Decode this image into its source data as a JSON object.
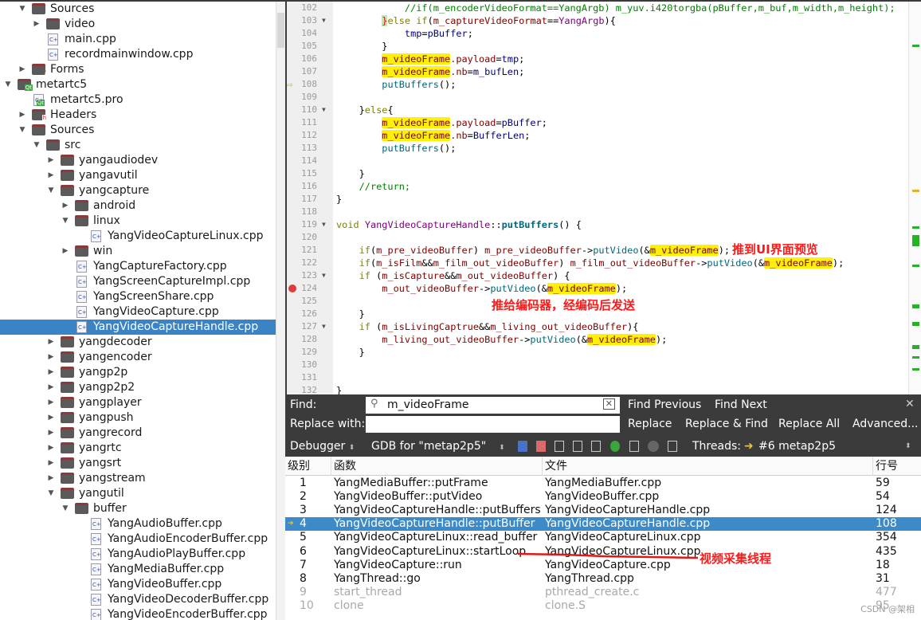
{
  "project_tree": {
    "items": [
      {
        "label": "Sources",
        "depth": 1,
        "kind": "cpp-folder",
        "arrow": "down"
      },
      {
        "label": "video",
        "depth": 2,
        "kind": "folder",
        "arrow": "right"
      },
      {
        "label": "main.cpp",
        "depth": 2,
        "kind": "file"
      },
      {
        "label": "recordmainwindow.cpp",
        "depth": 2,
        "kind": "file"
      },
      {
        "label": "Forms",
        "depth": 1,
        "kind": "forms-folder",
        "arrow": "right"
      },
      {
        "label": "metartc5",
        "depth": 0,
        "kind": "qt-project",
        "arrow": "down"
      },
      {
        "label": "metartc5.pro",
        "depth": 1,
        "kind": "pro-file"
      },
      {
        "label": "Headers",
        "depth": 1,
        "kind": "h-folder",
        "arrow": "right"
      },
      {
        "label": "Sources",
        "depth": 1,
        "kind": "cpp-folder",
        "arrow": "down"
      },
      {
        "label": "src",
        "depth": 2,
        "kind": "folder",
        "arrow": "down"
      },
      {
        "label": "yangaudiodev",
        "depth": 3,
        "kind": "folder",
        "arrow": "right"
      },
      {
        "label": "yangavutil",
        "depth": 3,
        "kind": "folder",
        "arrow": "right"
      },
      {
        "label": "yangcapture",
        "depth": 3,
        "kind": "folder",
        "arrow": "down"
      },
      {
        "label": "android",
        "depth": 4,
        "kind": "folder",
        "arrow": "right"
      },
      {
        "label": "linux",
        "depth": 4,
        "kind": "folder",
        "arrow": "down"
      },
      {
        "label": "YangVideoCaptureLinux.cpp",
        "depth": 5,
        "kind": "file"
      },
      {
        "label": "win",
        "depth": 4,
        "kind": "folder",
        "arrow": "right"
      },
      {
        "label": "YangCaptureFactory.cpp",
        "depth": 4,
        "kind": "file"
      },
      {
        "label": "YangScreenCaptureImpl.cpp",
        "depth": 4,
        "kind": "file"
      },
      {
        "label": "YangScreenShare.cpp",
        "depth": 4,
        "kind": "file"
      },
      {
        "label": "YangVideoCapture.cpp",
        "depth": 4,
        "kind": "file"
      },
      {
        "label": "YangVideoCaptureHandle.cpp",
        "depth": 4,
        "kind": "file",
        "selected": true
      },
      {
        "label": "yangdecoder",
        "depth": 3,
        "kind": "folder",
        "arrow": "right"
      },
      {
        "label": "yangencoder",
        "depth": 3,
        "kind": "folder",
        "arrow": "right"
      },
      {
        "label": "yangp2p",
        "depth": 3,
        "kind": "folder",
        "arrow": "right"
      },
      {
        "label": "yangp2p2",
        "depth": 3,
        "kind": "folder",
        "arrow": "right"
      },
      {
        "label": "yangplayer",
        "depth": 3,
        "kind": "folder",
        "arrow": "right"
      },
      {
        "label": "yangpush",
        "depth": 3,
        "kind": "folder",
        "arrow": "right"
      },
      {
        "label": "yangrecord",
        "depth": 3,
        "kind": "folder",
        "arrow": "right"
      },
      {
        "label": "yangrtc",
        "depth": 3,
        "kind": "folder",
        "arrow": "right"
      },
      {
        "label": "yangsrt",
        "depth": 3,
        "kind": "folder",
        "arrow": "right"
      },
      {
        "label": "yangstream",
        "depth": 3,
        "kind": "folder",
        "arrow": "right"
      },
      {
        "label": "yangutil",
        "depth": 3,
        "kind": "folder",
        "arrow": "down"
      },
      {
        "label": "buffer",
        "depth": 4,
        "kind": "folder",
        "arrow": "down"
      },
      {
        "label": "YangAudioBuffer.cpp",
        "depth": 5,
        "kind": "file"
      },
      {
        "label": "YangAudioEncoderBuffer.cpp",
        "depth": 5,
        "kind": "file"
      },
      {
        "label": "YangAudioPlayBuffer.cpp",
        "depth": 5,
        "kind": "file"
      },
      {
        "label": "YangMediaBuffer.cpp",
        "depth": 5,
        "kind": "file"
      },
      {
        "label": "YangVideoBuffer.cpp",
        "depth": 5,
        "kind": "file"
      },
      {
        "label": "YangVideoDecoderBuffer.cpp",
        "depth": 5,
        "kind": "file"
      },
      {
        "label": "YangVideoEncoderBuffer.cpp",
        "depth": 5,
        "kind": "file"
      }
    ]
  },
  "editor": {
    "current_line": 108,
    "breakpoint_line": 124,
    "lines": [
      {
        "n": 102,
        "s": [
          [
            "pl",
            "            "
          ],
          [
            "cm",
            "//if(m_encoderVideoFormat==YangArgb) m_yuv.i420torgba(pBuffer,m_buf,m_width,m_height);"
          ]
        ]
      },
      {
        "n": 103,
        "fold": true,
        "s": [
          [
            "pl",
            "        "
          ],
          [
            "bm",
            "}"
          ],
          [
            "kw",
            "else if"
          ],
          [
            "pl",
            "("
          ],
          [
            "fld",
            "m_captureVideoFormat"
          ],
          [
            "pl",
            "=="
          ],
          [
            "typ",
            "YangArgb"
          ],
          [
            "pl",
            "){"
          ]
        ]
      },
      {
        "n": 104,
        "s": [
          [
            "pl",
            "            "
          ],
          [
            "",
            "tmp"
          ],
          [
            "pl",
            "="
          ],
          [
            "",
            "pBuffer"
          ],
          [
            "pl",
            ";"
          ]
        ]
      },
      {
        "n": 105,
        "s": [
          [
            "pl",
            "        }"
          ]
        ]
      },
      {
        "n": 106,
        "s": [
          [
            "pl",
            "        "
          ],
          [
            "hl",
            "m_videoFrame"
          ],
          [
            "fld",
            ".payload"
          ],
          [
            "pl",
            "="
          ],
          [
            "",
            "tmp"
          ],
          [
            "pl",
            ";"
          ]
        ]
      },
      {
        "n": 107,
        "s": [
          [
            "pl",
            "        "
          ],
          [
            "hl",
            "m_videoFrame"
          ],
          [
            "fld",
            ".nb"
          ],
          [
            "pl",
            "="
          ],
          [
            "",
            "m_bufLen"
          ],
          [
            "pl",
            ";"
          ]
        ]
      },
      {
        "n": 108,
        "s": [
          [
            "pl",
            "        "
          ],
          [
            "fn",
            "putBuffers"
          ],
          [
            "pl",
            "();"
          ]
        ]
      },
      {
        "n": 109,
        "s": []
      },
      {
        "n": 110,
        "fold": true,
        "s": [
          [
            "pl",
            "    }"
          ],
          [
            "kw",
            "else"
          ],
          [
            "pl",
            "{"
          ]
        ]
      },
      {
        "n": 111,
        "s": [
          [
            "pl",
            "        "
          ],
          [
            "hl",
            "m_videoFrame"
          ],
          [
            "fld",
            ".payload"
          ],
          [
            "pl",
            "="
          ],
          [
            "",
            "pBuffer"
          ],
          [
            "pl",
            ";"
          ]
        ]
      },
      {
        "n": 112,
        "s": [
          [
            "pl",
            "        "
          ],
          [
            "hl",
            "m_videoFrame"
          ],
          [
            "fld",
            ".nb"
          ],
          [
            "pl",
            "="
          ],
          [
            "",
            "BufferLen"
          ],
          [
            "pl",
            ";"
          ]
        ]
      },
      {
        "n": 113,
        "s": [
          [
            "pl",
            "        "
          ],
          [
            "fn",
            "putBuffers"
          ],
          [
            "pl",
            "();"
          ]
        ]
      },
      {
        "n": 114,
        "s": []
      },
      {
        "n": 115,
        "s": [
          [
            "pl",
            "    }"
          ]
        ]
      },
      {
        "n": 116,
        "s": [
          [
            "pl",
            "    "
          ],
          [
            "cm",
            "//return;"
          ]
        ]
      },
      {
        "n": 117,
        "s": [
          [
            "pl",
            "}"
          ]
        ]
      },
      {
        "n": 118,
        "s": []
      },
      {
        "n": 119,
        "fold": true,
        "s": [
          [
            "kw",
            "void"
          ],
          [
            "pl",
            " "
          ],
          [
            "typ",
            "YangVideoCaptureHandle"
          ],
          [
            "pl",
            "::"
          ],
          [
            "bf",
            "putBuffers"
          ],
          [
            "pl",
            "() {"
          ]
        ]
      },
      {
        "n": 120,
        "s": []
      },
      {
        "n": 121,
        "s": [
          [
            "pl",
            "    "
          ],
          [
            "kw",
            "if"
          ],
          [
            "pl",
            "("
          ],
          [
            "fld",
            "m_pre_videoBuffer"
          ],
          [
            "pl",
            ") "
          ],
          [
            "fld",
            "m_pre_videoBuffer"
          ],
          [
            "pl",
            "->"
          ],
          [
            "fn",
            "putVideo"
          ],
          [
            "pl",
            "(&"
          ],
          [
            "hl",
            "m_videoFrame"
          ],
          [
            "pl",
            ");"
          ]
        ]
      },
      {
        "n": 122,
        "s": [
          [
            "pl",
            "    "
          ],
          [
            "kw",
            "if"
          ],
          [
            "pl",
            "("
          ],
          [
            "fld",
            "m_isFilm"
          ],
          [
            "pl",
            "&&"
          ],
          [
            "fld",
            "m_film_out_videoBuffer"
          ],
          [
            "pl",
            ") "
          ],
          [
            "fld",
            "m_film_out_videoBuffer"
          ],
          [
            "pl",
            "->"
          ],
          [
            "fn",
            "putVideo"
          ],
          [
            "pl",
            "(&"
          ],
          [
            "hl",
            "m_videoFrame"
          ],
          [
            "pl",
            ");"
          ]
        ]
      },
      {
        "n": 123,
        "fold": true,
        "s": [
          [
            "pl",
            "    "
          ],
          [
            "kw",
            "if"
          ],
          [
            "pl",
            " ("
          ],
          [
            "fld",
            "m_isCapture"
          ],
          [
            "pl",
            "&&"
          ],
          [
            "fld",
            "m_out_videoBuffer"
          ],
          [
            "pl",
            ") {"
          ]
        ]
      },
      {
        "n": 124,
        "s": [
          [
            "pl",
            "        "
          ],
          [
            "fld",
            "m_out_videoBuffer"
          ],
          [
            "pl",
            "->"
          ],
          [
            "fn",
            "putVideo"
          ],
          [
            "pl",
            "(&"
          ],
          [
            "hl",
            "m_videoFrame"
          ],
          [
            "pl",
            ");"
          ]
        ]
      },
      {
        "n": 125,
        "s": []
      },
      {
        "n": 126,
        "s": [
          [
            "pl",
            "    }"
          ]
        ]
      },
      {
        "n": 127,
        "fold": true,
        "s": [
          [
            "pl",
            "    "
          ],
          [
            "kw",
            "if"
          ],
          [
            "pl",
            " ("
          ],
          [
            "fld",
            "m_isLivingCaptrue"
          ],
          [
            "pl",
            "&&"
          ],
          [
            "fld",
            "m_living_out_videoBuffer"
          ],
          [
            "pl",
            "){"
          ]
        ]
      },
      {
        "n": 128,
        "s": [
          [
            "pl",
            "        "
          ],
          [
            "fld",
            "m_living_out_videoBuffer"
          ],
          [
            "pl",
            "->"
          ],
          [
            "fn",
            "putVideo"
          ],
          [
            "pl",
            "(&"
          ],
          [
            "hl",
            "m_videoFrame"
          ],
          [
            "pl",
            ");"
          ]
        ]
      },
      {
        "n": 129,
        "s": [
          [
            "pl",
            "    }"
          ]
        ]
      },
      {
        "n": 130,
        "s": []
      },
      {
        "n": 131,
        "s": []
      },
      {
        "n": 132,
        "s": [
          [
            "pl",
            "}"
          ]
        ]
      }
    ],
    "annotations": {
      "preview": "推到UI界面预览",
      "encoder": "推给编码器，经编码后发送"
    }
  },
  "find_bar": {
    "find_label": "Find:",
    "find_value": "m_videoFrame",
    "replace_label": "Replace with:",
    "replace_value": "",
    "find_previous": "Find Previous",
    "find_next": "Find Next",
    "replace": "Replace",
    "replace_find": "Replace & Find",
    "replace_all": "Replace All",
    "advanced": "Advanced...",
    "close": "✕"
  },
  "debugger_bar": {
    "mode": "Debugger",
    "engine": "GDB for \"metap2p5\"",
    "threads_label": "Threads:",
    "thread": "#6 metap2p5"
  },
  "stack": {
    "headers": [
      "级别",
      "函数",
      "文件",
      "行号"
    ],
    "rows": [
      {
        "level": "1",
        "func": "YangMediaBuffer::putFrame",
        "file": "YangMediaBuffer.cpp",
        "line": "59"
      },
      {
        "level": "2",
        "func": "YangVideoBuffer::putVideo",
        "file": "YangVideoBuffer.cpp",
        "line": "54"
      },
      {
        "level": "3",
        "func": "YangVideoCaptureHandle::putBuffers",
        "file": "YangVideoCaptureHandle.cpp",
        "line": "124"
      },
      {
        "level": "4",
        "func": "YangVideoCaptureHandle::putBuffer",
        "file": "YangVideoCaptureHandle.cpp",
        "line": "108",
        "current": true
      },
      {
        "level": "5",
        "func": "YangVideoCaptureLinux::read_buffer",
        "file": "YangVideoCaptureLinux.cpp",
        "line": "354"
      },
      {
        "level": "6",
        "func": "YangVideoCaptureLinux::startLoop",
        "file": "YangVideoCaptureLinux.cpp",
        "line": "435"
      },
      {
        "level": "7",
        "func": "YangVideoCapture::run",
        "file": "YangVideoCapture.cpp",
        "line": "18"
      },
      {
        "level": "8",
        "func": "YangThread::go",
        "file": "YangThread.cpp",
        "line": "31"
      },
      {
        "level": "9",
        "func": "start_thread",
        "file": "pthread_create.c",
        "line": "477",
        "dim": true
      },
      {
        "level": "10",
        "func": "clone",
        "file": "clone.S",
        "line": "95",
        "dim": true
      }
    ],
    "annotation": "视频采集线程"
  },
  "watermark": "CSDN @架相",
  "colors": {
    "selection": "#3a84c6",
    "highlight": "#ffef0b",
    "annotation": "#ff1a1a",
    "toolbar": "#3b3b3b"
  }
}
